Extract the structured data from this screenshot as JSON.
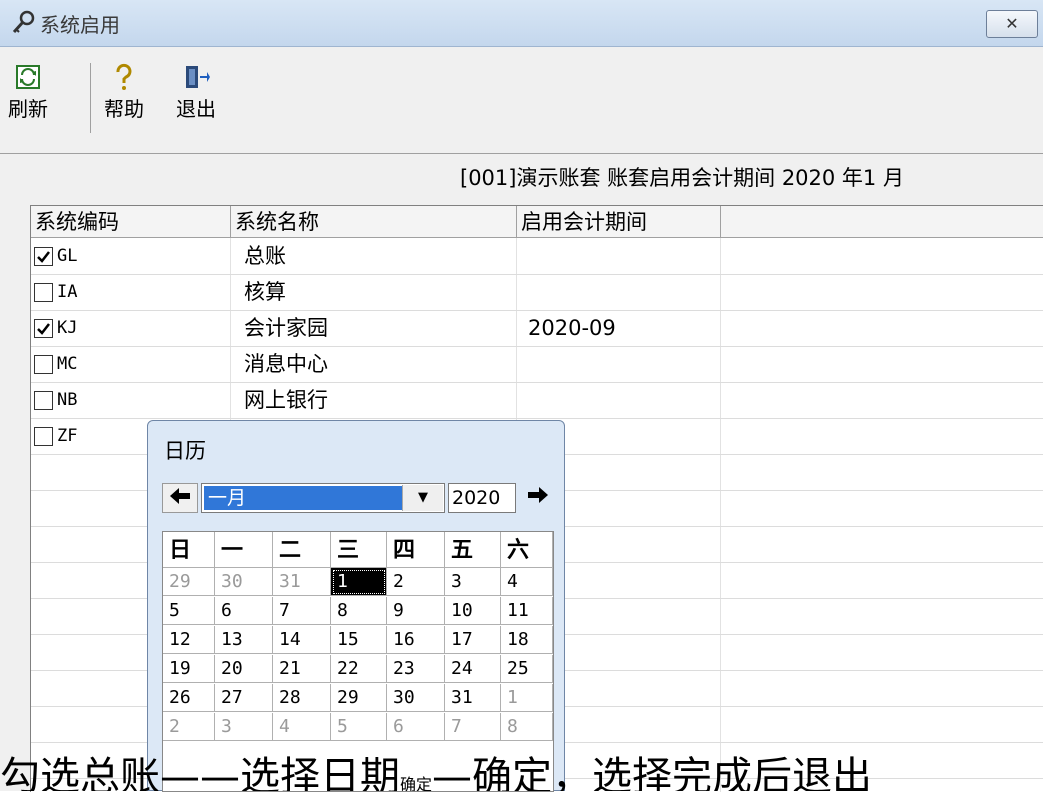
{
  "window": {
    "title": "系统启用",
    "close_symbol": "✕"
  },
  "toolbar": {
    "refresh_label": "刷新",
    "help_label": "帮助",
    "exit_label": "退出"
  },
  "account_info": "[001]演示账套 账套启用会计期间 2020 年1 月",
  "table": {
    "headers": [
      "系统编码",
      "系统名称",
      "启用会计期间"
    ],
    "rows": [
      {
        "code": "GL",
        "name": "总账",
        "period": "",
        "checked": true
      },
      {
        "code": "IA",
        "name": "核算",
        "period": "",
        "checked": false
      },
      {
        "code": "KJ",
        "name": "会计家园",
        "period": "2020-09",
        "checked": true
      },
      {
        "code": "MC",
        "name": "消息中心",
        "period": "",
        "checked": false
      },
      {
        "code": "NB",
        "name": "网上银行",
        "period": "",
        "checked": false
      },
      {
        "code": "ZF",
        "name": "",
        "period": "",
        "checked": false
      }
    ]
  },
  "calendar": {
    "title": "日历",
    "month": "一月",
    "year": "2020",
    "weekdays": [
      "日",
      "一",
      "二",
      "三",
      "四",
      "五",
      "六"
    ],
    "weeks": [
      [
        "29",
        "30",
        "31",
        "1",
        "2",
        "3",
        "4"
      ],
      [
        "5",
        "6",
        "7",
        "8",
        "9",
        "10",
        "11"
      ],
      [
        "12",
        "13",
        "14",
        "15",
        "16",
        "17",
        "18"
      ],
      [
        "19",
        "20",
        "21",
        "22",
        "23",
        "24",
        "25"
      ],
      [
        "26",
        "27",
        "28",
        "29",
        "30",
        "31",
        "1"
      ],
      [
        "2",
        "3",
        "4",
        "5",
        "6",
        "7",
        "8"
      ]
    ],
    "selected_day": "1"
  },
  "caption": {
    "part1": "勾选总账——选择日期",
    "tiny": "确定",
    "part2": "—确定，选择完成后退出"
  }
}
